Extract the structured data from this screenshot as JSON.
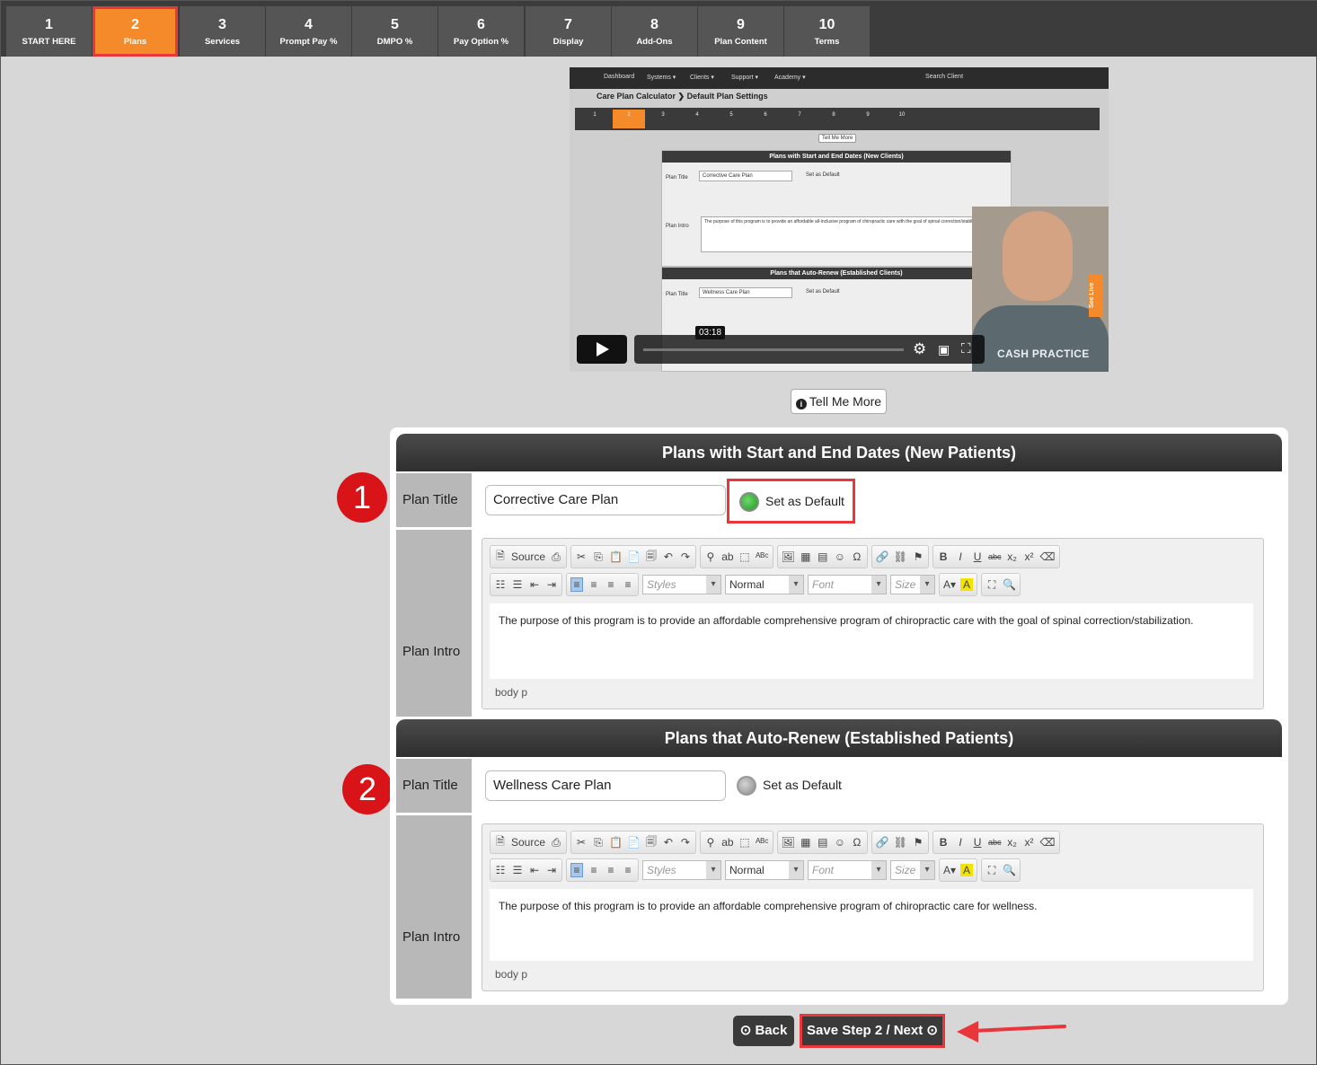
{
  "steps": [
    {
      "num": "1",
      "label": "START HERE"
    },
    {
      "num": "2",
      "label": "Plans"
    },
    {
      "num": "3",
      "label": "Services"
    },
    {
      "num": "4",
      "label": "Prompt Pay %"
    },
    {
      "num": "5",
      "label": "DMPO %"
    },
    {
      "num": "6",
      "label": "Pay Option %"
    },
    {
      "num": "7",
      "label": "Display"
    },
    {
      "num": "8",
      "label": "Add-Ons"
    },
    {
      "num": "9",
      "label": "Plan Content"
    },
    {
      "num": "10",
      "label": "Terms"
    }
  ],
  "active_step": 2,
  "video": {
    "nav": [
      "Dashboard",
      "Systems ▾",
      "Clients ▾",
      "Support ▾",
      "Academy ▾",
      "Search Client"
    ],
    "breadcrumb": "Care Plan Calculator ❯ Default Plan Settings",
    "tell_more": "Tell Me More",
    "section1_title": "Plans with Start and End Dates (New Clients)",
    "section2_title": "Plans that Auto-Renew (Established Clients)",
    "plan1": "Corrective Care Plan",
    "plan2": "Wellness Care Plan",
    "set_default": "Set as Default",
    "plan_title_label": "Plan Title",
    "plan_intro_label": "Plan Intro",
    "intro_text": "The purpose of this program is to provide an affordable all-inclusive program of chiropractic care with the goal of spinal correction/stabilization.",
    "time": "03:18",
    "brand": "CASH PRACTICE",
    "see_live": "See Live"
  },
  "tell_me_more": "Tell Me More",
  "section1": {
    "title": "Plans with Start and End Dates (New Patients)",
    "plan_title_label": "Plan Title",
    "plan_title_value": "Corrective Care Plan",
    "set_default_label": "Set as Default",
    "set_default_checked": true,
    "plan_intro_label": "Plan Intro",
    "intro_text": "The purpose of this program is to provide an affordable comprehensive program of chiropractic care with the goal of spinal correction/stabilization.",
    "path": "body  p",
    "bubble": "1"
  },
  "section2": {
    "title": "Plans that Auto-Renew (Established Patients)",
    "plan_title_label": "Plan Title",
    "plan_title_value": "Wellness Care Plan",
    "set_default_label": "Set as Default",
    "set_default_checked": false,
    "plan_intro_label": "Plan Intro",
    "intro_text": "The purpose of this program is to provide an affordable comprehensive program of chiropractic care for wellness.",
    "path": "body  p",
    "bubble": "2"
  },
  "editor": {
    "source_label": "Source",
    "styles": "Styles",
    "format": "Normal",
    "font": "Font",
    "size": "Size"
  },
  "buttons": {
    "back": "Back",
    "save": "Save Step 2 / Next"
  },
  "colors": {
    "active_step": "#f58a2a",
    "highlight": "#e8363a",
    "bubble": "#d91419"
  }
}
